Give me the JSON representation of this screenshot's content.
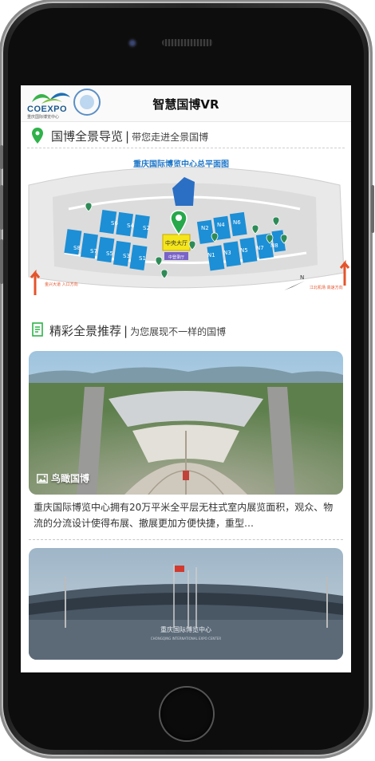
{
  "header": {
    "title": "智慧国博VR",
    "brand": "COEXPO",
    "brand_sub": "重庆国际博览中心",
    "logo2_icon": "emblem-icon"
  },
  "section1": {
    "heading": "国博全景导览",
    "separator": "|",
    "subtitle": "带您走进全景国博",
    "icon": "location-pin-icon",
    "accent": "#2fb24a"
  },
  "map": {
    "title": "重庆国际博览中心总平面图",
    "halls_south": [
      "S6",
      "S4",
      "S2",
      "S8",
      "S7",
      "S5",
      "S3",
      "S1"
    ],
    "halls_north": [
      "N2",
      "N4",
      "N6",
      "N1",
      "N3",
      "N5",
      "N7",
      "N8"
    ],
    "center": "中央大厅",
    "center_sub": "中登录厅",
    "label_left": "金兴大道\n入口方向",
    "label_right": "江北机场\n高速方向",
    "compass": "N",
    "colors": {
      "hall": "#1c8fd6",
      "center": "#f5e61b",
      "pin": "#27a84a"
    }
  },
  "section2": {
    "heading": "精彩全景推荐",
    "separator": "|",
    "subtitle": "为您展现不一样的国博",
    "icon": "document-icon"
  },
  "cards": [
    {
      "badge": "鸟瞰国博",
      "badge_icon": "image-icon",
      "desc": "重庆国际博览中心拥有20万平米全平层无柱式室内展览面积，观众、物流的分流设计使得布展、撤展更加方便快捷，重型…"
    },
    {
      "sign": "重庆国际博览中心",
      "sign_en": "CHONGQING INTERNATIONAL EXPO CENTER"
    }
  ]
}
